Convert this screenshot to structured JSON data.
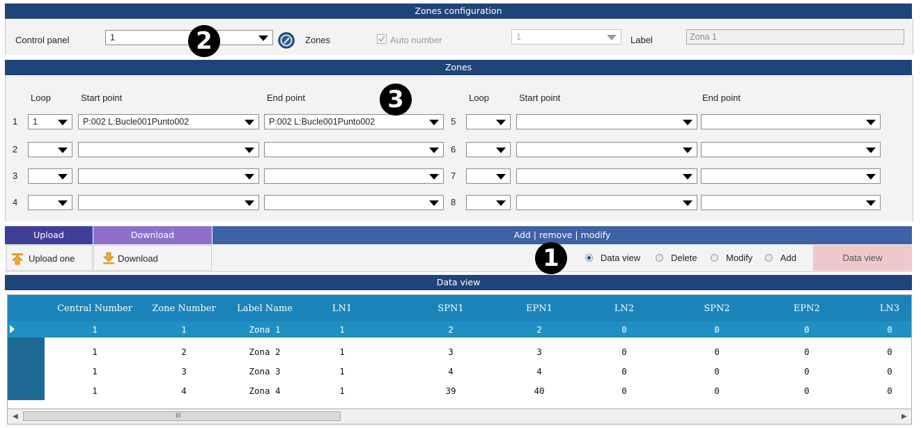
{
  "header": {
    "title": "Zones configuration"
  },
  "top_row": {
    "control_panel_label": "Control panel",
    "control_panel_value": "1",
    "zones_label": "Zones",
    "auto_number_label": "Auto number",
    "zones_number_value": "1",
    "label_label": "Label",
    "label_value": "Zona 1"
  },
  "zones_section": {
    "title": "Zones",
    "loop_header": "Loop",
    "start_header": "Start point",
    "end_header": "End point",
    "left_rows": [
      {
        "num": "1",
        "loop": "1",
        "start": "P:002 L:Bucle001Punto002",
        "end": "P:002 L:Bucle001Punto002"
      },
      {
        "num": "2",
        "loop": "",
        "start": "",
        "end": ""
      },
      {
        "num": "3",
        "loop": "",
        "start": "",
        "end": ""
      },
      {
        "num": "4",
        "loop": "",
        "start": "",
        "end": ""
      }
    ],
    "right_rows": [
      {
        "num": "5",
        "loop": "",
        "start": "",
        "end": ""
      },
      {
        "num": "6",
        "loop": "",
        "start": "",
        "end": ""
      },
      {
        "num": "7",
        "loop": "",
        "start": "",
        "end": ""
      },
      {
        "num": "8",
        "loop": "",
        "start": "",
        "end": ""
      }
    ]
  },
  "actions": {
    "upload_tab": "Upload",
    "download_tab": "Download",
    "arm_tab": "Add | remove | modify",
    "upload_one": "Upload one",
    "download_btn": "Download",
    "radios": [
      "Data view",
      "Delete",
      "Modify",
      "Add"
    ],
    "selected_radio": "Data view",
    "action_button": "Data view"
  },
  "callouts": {
    "one": "1",
    "two": "2",
    "three": "3"
  },
  "data_view": {
    "title": "Data view",
    "columns": [
      "Central Number",
      "Zone Number",
      "Label Name",
      "LN1",
      "SPN1",
      "EPN1",
      "LN2",
      "SPN2",
      "EPN2",
      "LN3"
    ],
    "rows": [
      [
        "1",
        "1",
        "Zona 1",
        "1",
        "2",
        "2",
        "0",
        "0",
        "0",
        "0"
      ],
      [
        "1",
        "2",
        "Zona 2",
        "1",
        "3",
        "3",
        "0",
        "0",
        "0",
        "0"
      ],
      [
        "1",
        "3",
        "Zona 3",
        "1",
        "4",
        "4",
        "0",
        "0",
        "0",
        "0"
      ],
      [
        "1",
        "4",
        "Zona 4",
        "1",
        "39",
        "40",
        "0",
        "0",
        "0",
        "0"
      ]
    ],
    "scroll_grip": "III"
  },
  "colors": {
    "title_bar": "#1e4478",
    "purple_tab": "#3f3f99",
    "download_tab": "#8e6fc9",
    "selected_row": "#1f8fc4",
    "header_row": "#1a84ba",
    "action_button": "#efc9c9"
  }
}
